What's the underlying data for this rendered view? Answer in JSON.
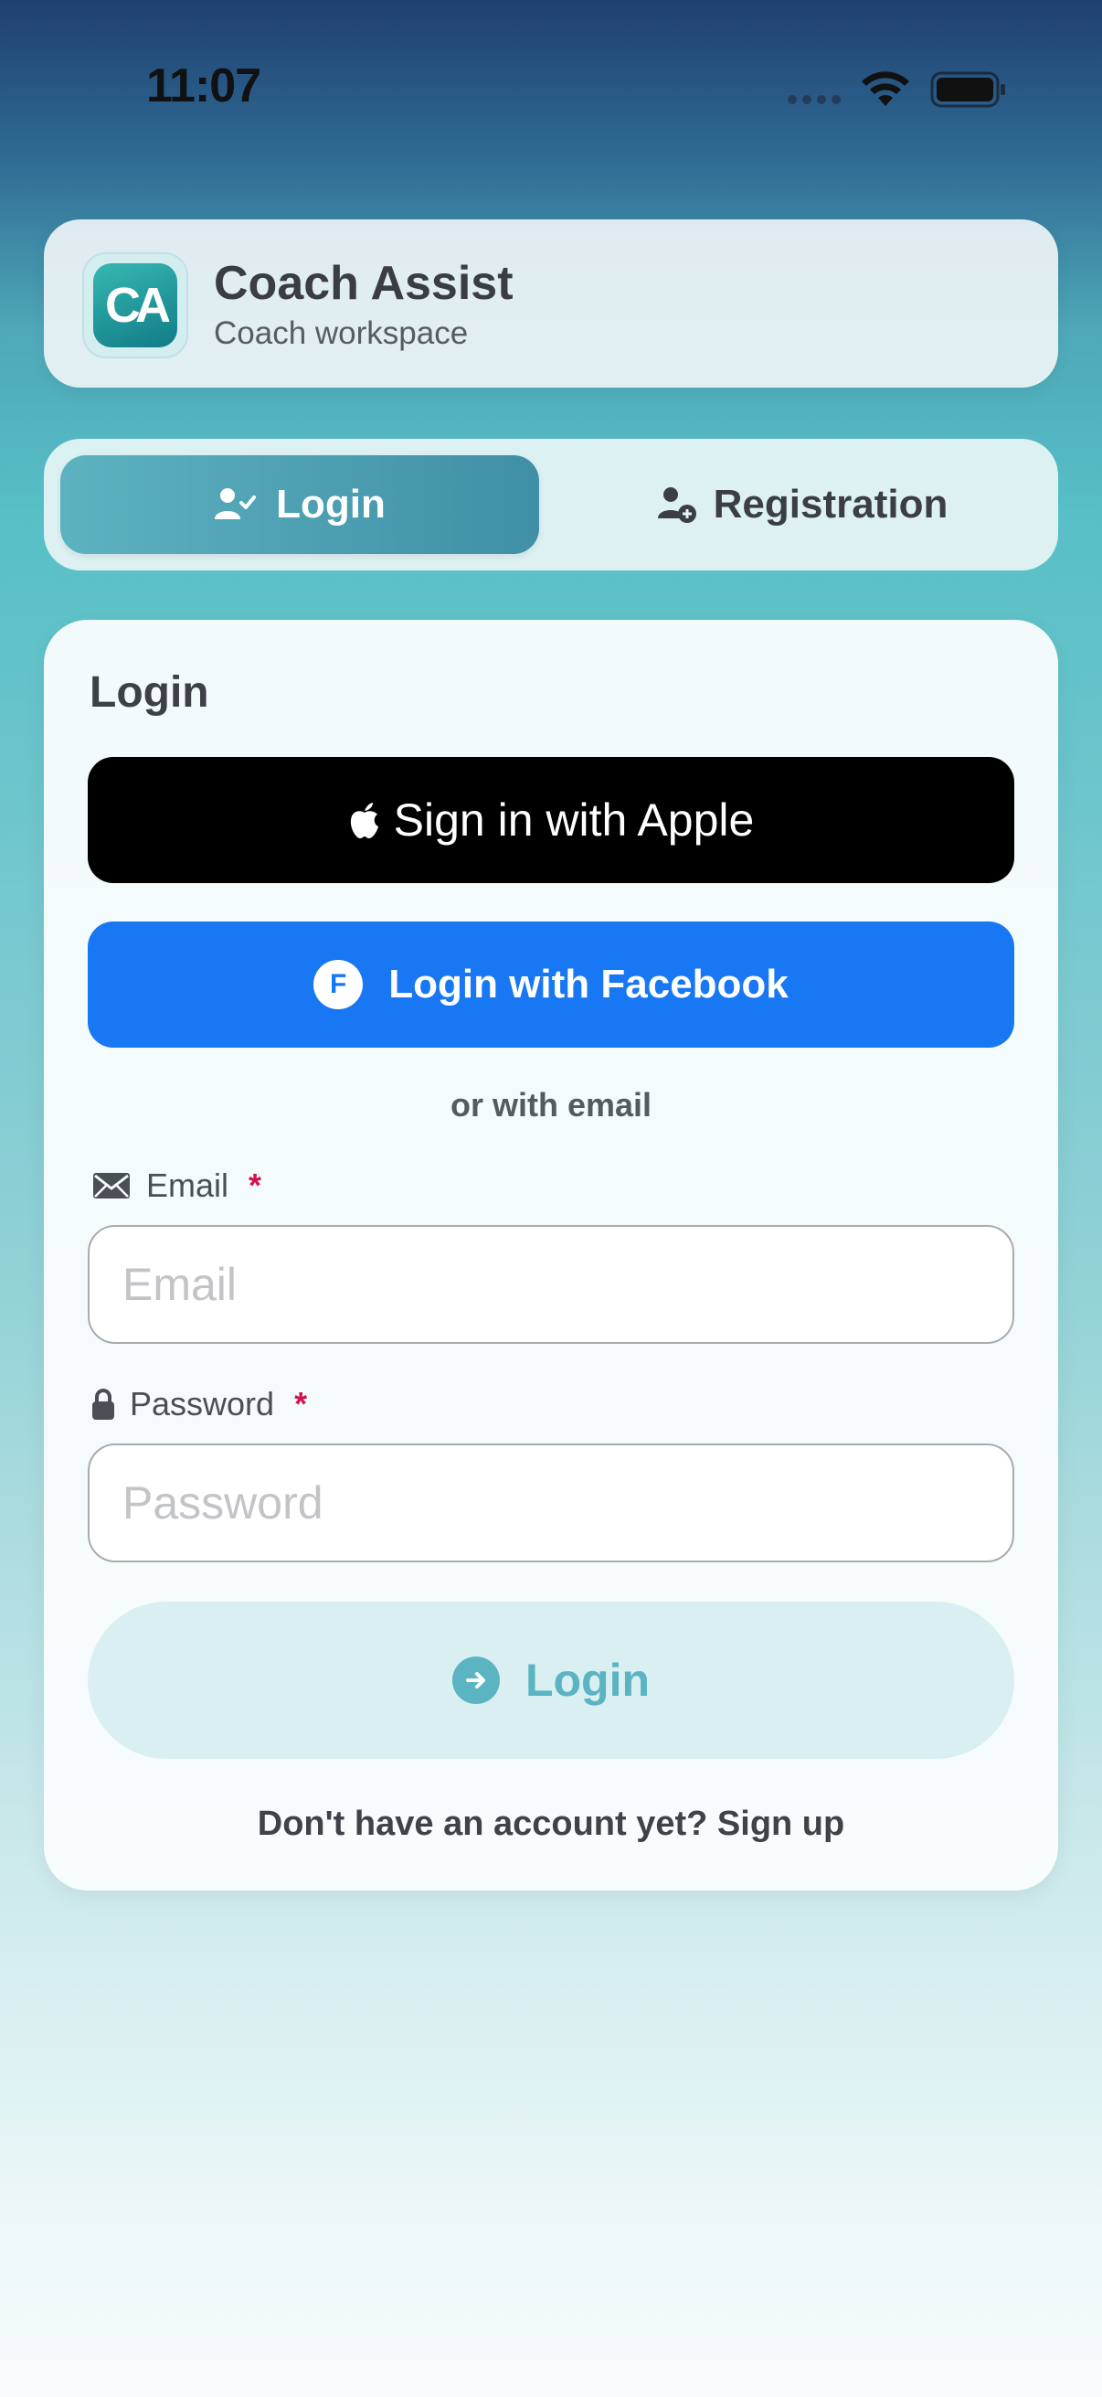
{
  "status_bar": {
    "time": "11:07"
  },
  "header": {
    "logo_text": "CA",
    "title": "Coach Assist",
    "subtitle": "Coach workspace"
  },
  "tabs": [
    {
      "label": "Login",
      "icon": "person-check-icon",
      "selected": true
    },
    {
      "label": "Registration",
      "icon": "person-add-icon",
      "selected": false
    }
  ],
  "form": {
    "title": "Login",
    "apple_button": "Sign in with Apple",
    "facebook_button": "Login with Facebook",
    "facebook_badge": "F",
    "divider": "or with email",
    "email_label": "Email",
    "email_placeholder": "Email",
    "email_value": "",
    "password_label": "Password",
    "password_placeholder": "Password",
    "password_value": "",
    "required_marker": "*",
    "login_button": "Login",
    "signup_prompt": "Don't have an account yet? Sign up"
  },
  "colors": {
    "accent": "#5bb4c2",
    "facebook": "#1877f2",
    "apple": "#000000",
    "required": "#d0124f"
  }
}
